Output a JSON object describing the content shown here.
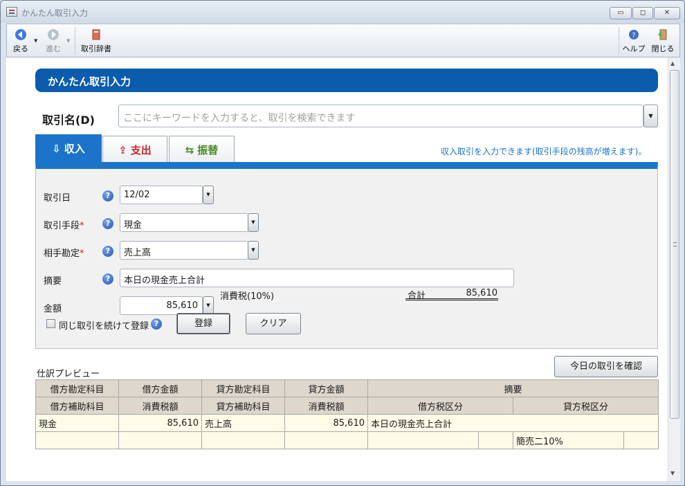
{
  "window": {
    "title": "かんたん取引入力",
    "buttons": {
      "minimize": "▭",
      "maximize": "◻",
      "close": "✕"
    }
  },
  "toolbar": {
    "back": "戻る",
    "forward": "進む",
    "dictionary": "取引辞書",
    "help": "ヘルプ",
    "close": "閉じる"
  },
  "header": {
    "title": "かんたん取引入力"
  },
  "name_field": {
    "label": "取引名(D)",
    "placeholder": "ここにキーワードを入力すると、取引を検索できます"
  },
  "tabs": [
    {
      "label": "収入",
      "active": true
    },
    {
      "label": "支出",
      "active": false
    },
    {
      "label": "振替",
      "active": false
    }
  ],
  "tab_info": "収入取引を入力できます(取引手段の残高が増えます)。",
  "form": {
    "date_label": "取引日",
    "date_value": "12/02",
    "method_label": "取引手段",
    "method_value": "現金",
    "account_label": "相手勘定",
    "account_value": "売上高",
    "summary_label": "摘要",
    "summary_value": "本日の現金売上合計",
    "amount_label": "金額",
    "amount_value": "85,610",
    "tax_label": "消費税(10%)",
    "total_label": "合計",
    "total_value": "85,610",
    "required_mark": "*",
    "help_mark": "?",
    "repeat_label": "同じ取引を続けて登録",
    "register_button": "登録",
    "clear_button": "クリア"
  },
  "preview": {
    "title": "仕訳プレビュー",
    "today_button": "今日の取引を確認",
    "header_row1": [
      "借方勘定科目",
      "借方金額",
      "貸方勘定科目",
      "貸方金額",
      "摘要"
    ],
    "header_row2": [
      "借方補助科目",
      "消費税額",
      "貸方補助科目",
      "消費税額",
      "借方税区分",
      "貸方税区分"
    ],
    "row1": [
      "現金",
      "85,610",
      "売上高",
      "85,610",
      "本日の現金売上合計"
    ],
    "row2": [
      "",
      "",
      "",
      "",
      "",
      "",
      "簡売二10%",
      ""
    ]
  },
  "colors": {
    "header_blue": "#0b5cad",
    "tab_blue": "#1b74c9",
    "expense_red": "#c62828",
    "transfer_green": "#4b8a22",
    "required_red": "#d21a1a",
    "info_blue": "#1a73c8",
    "table_header": "#ddd7cc",
    "table_cell": "#fffbe9"
  },
  "icons": [
    "back-arrow-icon",
    "forward-arrow-icon",
    "dictionary-icon",
    "help-icon",
    "exit-door-icon",
    "income-icon",
    "expense-icon",
    "transfer-icon",
    "dropdown-arrow-icon"
  ]
}
